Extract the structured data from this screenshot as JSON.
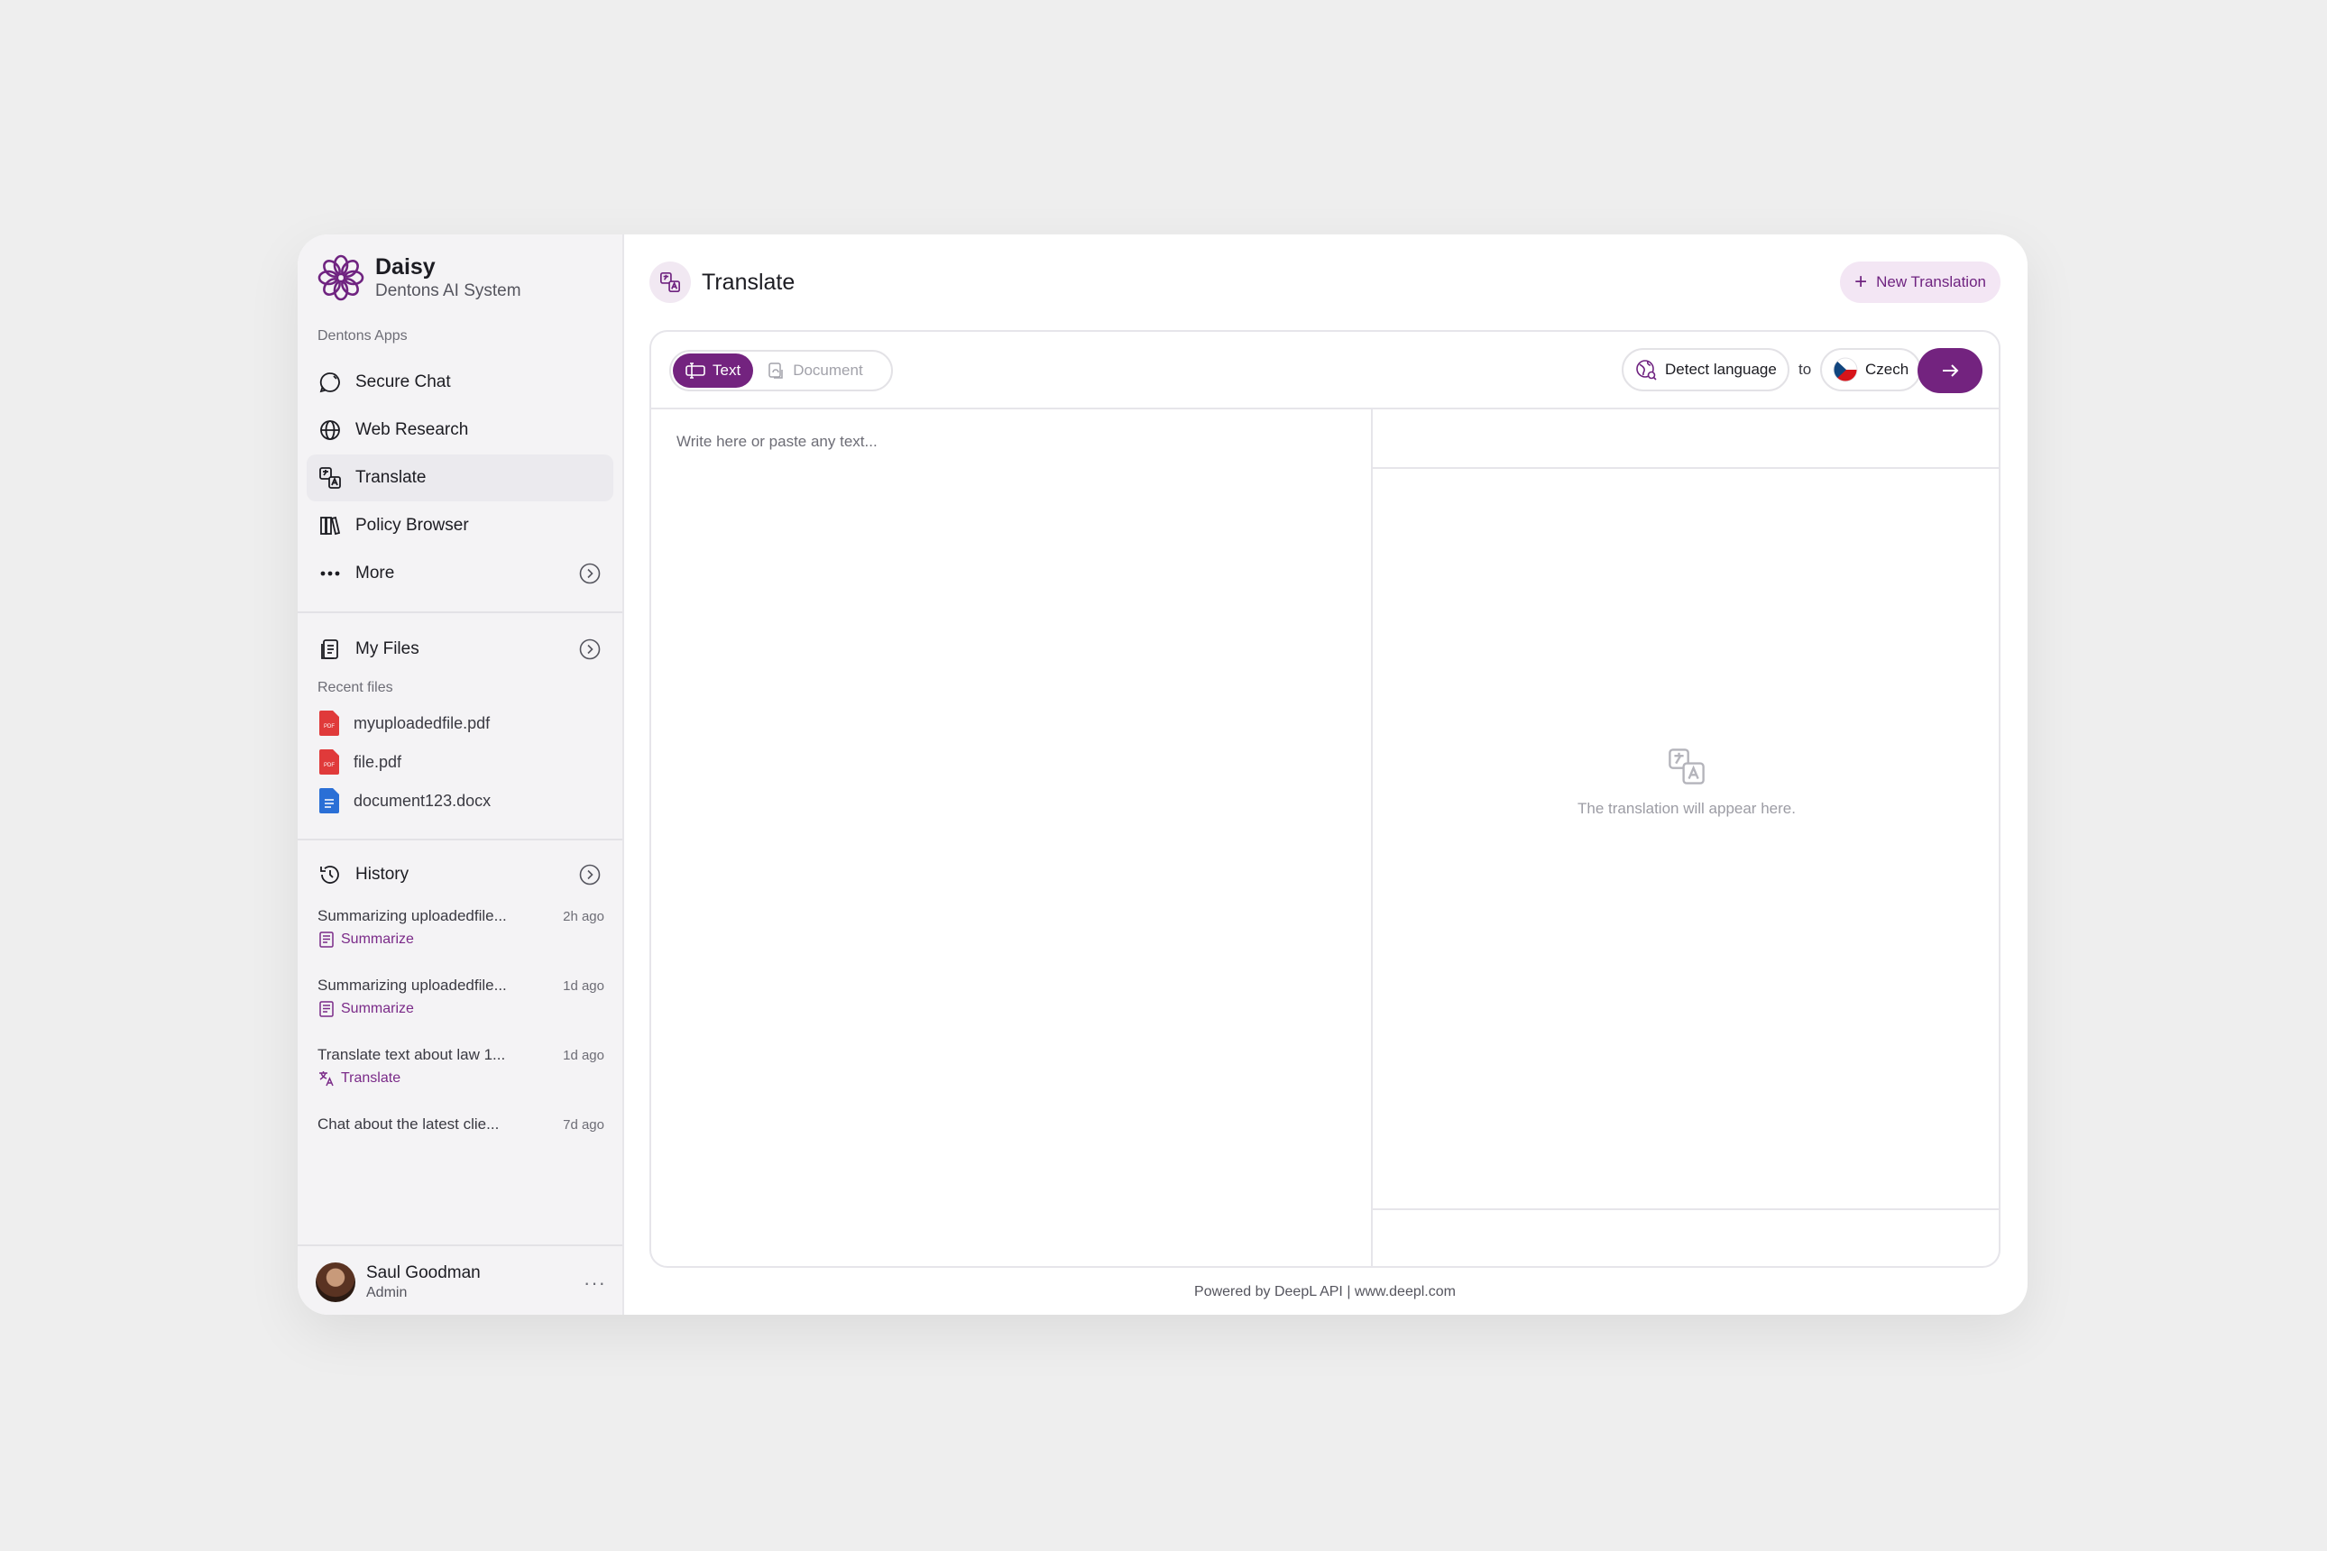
{
  "brand": {
    "name": "Daisy",
    "subtitle": "Dentons AI System"
  },
  "sidebar": {
    "apps_label": "Dentons Apps",
    "apps": [
      {
        "label": "Secure Chat",
        "icon": "chat-icon"
      },
      {
        "label": "Web Research",
        "icon": "globe-icon"
      },
      {
        "label": "Translate",
        "icon": "translate-icon",
        "active": true
      },
      {
        "label": "Policy Browser",
        "icon": "books-icon"
      },
      {
        "label": "More",
        "icon": "more-dots-icon"
      }
    ],
    "files": {
      "title": "My Files",
      "recent_label": "Recent files",
      "items": [
        {
          "name": "myuploadedfile.pdf",
          "type": "pdf"
        },
        {
          "name": "file.pdf",
          "type": "pdf"
        },
        {
          "name": "document123.docx",
          "type": "docx"
        }
      ]
    },
    "history": {
      "title": "History",
      "items": [
        {
          "title": "Summarizing uploadedfile...",
          "time": "2h ago",
          "tag": "Summarize"
        },
        {
          "title": "Summarizing uploadedfile...",
          "time": "1d ago",
          "tag": "Summarize"
        },
        {
          "title": "Translate text about law 1...",
          "time": "1d ago",
          "tag": "Translate"
        },
        {
          "title": "Chat about the latest clie...",
          "time": "7d ago",
          "tag": ""
        }
      ]
    },
    "user": {
      "name": "Saul Goodman",
      "role": "Admin"
    }
  },
  "main": {
    "title": "Translate",
    "new_button": "New Translation",
    "modes": {
      "text": "Text",
      "document": "Document"
    },
    "source_language": "Detect language",
    "to_label": "to",
    "target_language": "Czech",
    "input_placeholder": "Write here or paste any text...",
    "output_placeholder": "The translation will appear here.",
    "footer": "Powered by DeepL API | www.deepl.com"
  },
  "colors": {
    "accent": "#73237f",
    "accent_light": "#f3e6f4"
  }
}
